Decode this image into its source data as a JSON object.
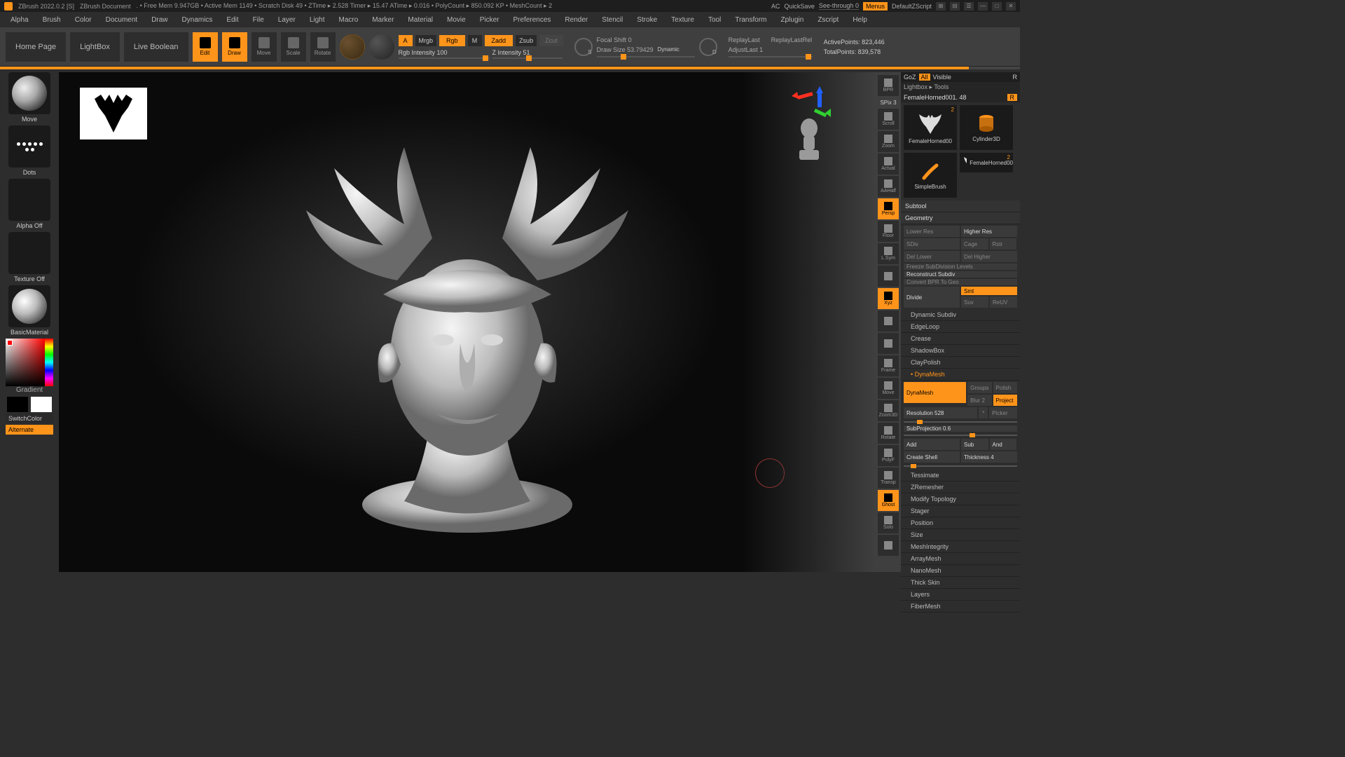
{
  "title": {
    "app": "ZBrush 2022.0.2 [S]",
    "doc": "ZBrush Document",
    "stats": ". • Free Mem 9.947GB • Active Mem 1149 • Scratch Disk 49 •  ZTime ▸ 2.528 Timer ▸ 15.47 ATime ▸ 0.016  • PolyCount ▸ 850.092 KP  • MeshCount ▸ 2",
    "ac": "AC",
    "quicksave": "QuickSave",
    "seethrough": "See-through  0",
    "menus": "Menus",
    "defscript": "DefaultZScript"
  },
  "menu": [
    "Alpha",
    "Brush",
    "Color",
    "Document",
    "Draw",
    "Dynamics",
    "Edit",
    "File",
    "Layer",
    "Light",
    "Macro",
    "Marker",
    "Material",
    "Movie",
    "Picker",
    "Preferences",
    "Render",
    "Stencil",
    "Stroke",
    "Texture",
    "Tool",
    "Transform",
    "Zplugin",
    "Zscript",
    "Help"
  ],
  "toolbar": {
    "home": "Home Page",
    "lightbox": "LightBox",
    "livebool": "Live Boolean",
    "edit": "Edit",
    "draw": "Draw",
    "move": "Move",
    "scale": "Scale",
    "rotate": "Rotate",
    "a": "A",
    "mrgb": "Mrgb",
    "rgb": "Rgb",
    "m": "M",
    "zadd": "Zadd",
    "zsub": "Zsub",
    "zcut": "Zcut",
    "rgbint": "Rgb Intensity 100",
    "zint": "Z Intensity 51",
    "focal": "Focal Shift 0",
    "drawsize": "Draw Size 53.79429",
    "dynamic": "Dynamic",
    "replay": "ReplayLast",
    "replayrel": "ReplayLastRel",
    "adjust": "AdjustLast 1",
    "active": "ActivePoints: 823,446",
    "total": "TotalPoints: 839,578"
  },
  "left": {
    "move": "Move",
    "dots": "Dots",
    "alphaoff": "Alpha Off",
    "texoff": "Texture Off",
    "mat": "BasicMaterial",
    "gradient": "Gradient",
    "switch": "SwitchColor",
    "alternate": "Alternate"
  },
  "vstrip": {
    "spix": "SPix 3",
    "items": [
      "BPR",
      "Scroll",
      "Zoom",
      "Actual",
      "AAHalf",
      "Persp",
      "Floor",
      "L.Sym",
      "",
      "Xyz",
      "",
      "",
      "Frame",
      "Move",
      "Zoom3D",
      "Rotate",
      "PolyF",
      "Transp",
      "Ghost",
      "Solo",
      ""
    ],
    "spec": [
      "Persp",
      "Xyz",
      "Ghost"
    ]
  },
  "right": {
    "goz": "GoZ",
    "all": "All",
    "visible": "Visible",
    "r": "R",
    "lightbox": "Lightbox ▸ Tools",
    "toolname": "FemaleHorned001.  48",
    "toolR": "R",
    "tools": [
      {
        "n": "FemaleHorned00",
        "c": "2"
      },
      {
        "n": "Cylinder3D",
        "c": ""
      },
      {
        "n": "SimpleBrush",
        "c": ""
      }
    ],
    "tool2": {
      "n": "FemaleHorned00",
      "c": "2"
    },
    "sections": [
      "Subtool",
      "Geometry"
    ],
    "geo": {
      "lower": "Lower Res",
      "higher": "Higher Res",
      "sdiv": "SDiv",
      "cage": "Cage",
      "rstr": "Rstr",
      "dellower": "Del Lower",
      "delhigher": "Del Higher",
      "freeze": "Freeze SubDivision Levels",
      "recon": "Reconstruct Subdiv",
      "convbpr": "Convert BPR To Geo",
      "divide": "Divide",
      "smt": "Smt",
      "suv": "Suv",
      "reuv": "ReUV"
    },
    "subsections": [
      "Dynamic Subdiv",
      "EdgeLoop",
      "Crease",
      "ShadowBox",
      "ClayPolish",
      "DynaMesh"
    ],
    "dyna": {
      "dynamesh": "DynaMesh",
      "groups": "Groups",
      "polish": "Polish",
      "blur": "Blur 2",
      "project": "Project",
      "res": "Resolution 528",
      "dot": "*",
      "picker": "Picker",
      "subproj": "SubProjection 0.6",
      "add": "Add",
      "sub": "Sub",
      "and": "And",
      "shell": "Create Shell",
      "thick": "Thickness 4"
    },
    "rest": [
      "Tessimate",
      "ZRemesher",
      "Modify Topology",
      "Stager",
      "Position",
      "Size",
      "MeshIntegrity"
    ],
    "rest2": [
      "ArrayMesh",
      "NanoMesh",
      "Thick Skin",
      "Layers",
      "FiberMesh"
    ]
  }
}
